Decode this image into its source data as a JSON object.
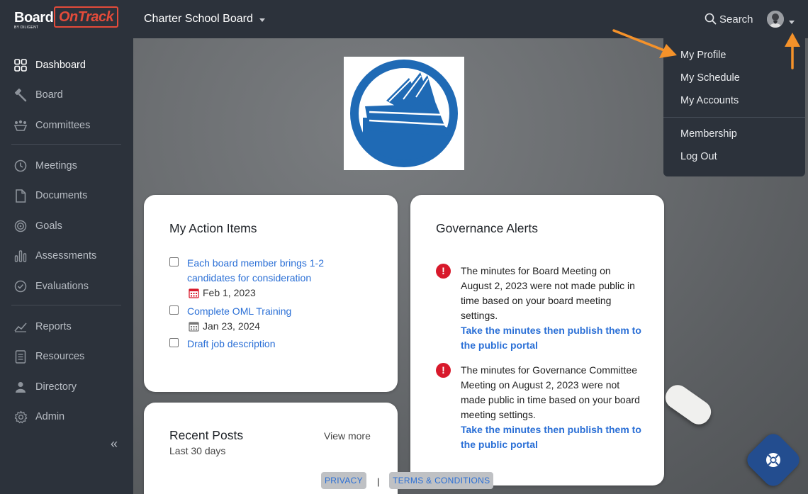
{
  "app": {
    "logo_board": "Board",
    "logo_ontrack": "OnTrack",
    "logo_by": "BY DILIGENT",
    "org_title": "Charter School Board",
    "search_label": "Search"
  },
  "sidebar": {
    "items": [
      {
        "label": "Dashboard",
        "icon": "dashboard-icon"
      },
      {
        "label": "Board",
        "icon": "gavel-icon"
      },
      {
        "label": "Committees",
        "icon": "committees-icon"
      },
      {
        "label": "Meetings",
        "icon": "clock-icon"
      },
      {
        "label": "Documents",
        "icon": "document-icon"
      },
      {
        "label": "Goals",
        "icon": "target-icon"
      },
      {
        "label": "Assessments",
        "icon": "bar-chart-icon"
      },
      {
        "label": "Evaluations",
        "icon": "check-circle-icon"
      },
      {
        "label": "Reports",
        "icon": "line-chart-icon"
      },
      {
        "label": "Resources",
        "icon": "list-doc-icon"
      },
      {
        "label": "Directory",
        "icon": "person-icon"
      },
      {
        "label": "Admin",
        "icon": "gear-icon"
      }
    ],
    "collapse_glyph": "«"
  },
  "user_menu": {
    "items": [
      "My Profile",
      "My Schedule",
      "My Accounts",
      "Membership",
      "Log Out"
    ]
  },
  "action_items": {
    "title": "My Action Items",
    "items": [
      {
        "text": "Each board member brings 1-2 candidates for consideration",
        "date": "Feb 1, 2023",
        "overdue": true
      },
      {
        "text": "Complete OML Training",
        "date": "Jan 23, 2024",
        "overdue": false
      },
      {
        "text": "Draft job description",
        "date": ""
      }
    ]
  },
  "governance_alerts": {
    "title": "Governance Alerts",
    "alerts": [
      {
        "text": "The minutes for Board Meeting on August 2, 2023 were not made public in time based on your board meeting settings.",
        "link": "Take the minutes then publish them to the public portal"
      },
      {
        "text": "The minutes for Governance Committee Meeting on August 2, 2023 were not made public in time based on your board meeting settings.",
        "link": "Take the minutes then publish them to the public portal"
      }
    ]
  },
  "recent_posts": {
    "title": "Recent Posts",
    "subtitle": "Last 30 days",
    "view_more": "View more"
  },
  "footer": {
    "privacy": "PRIVACY",
    "separator": "|",
    "terms": "TERMS & CONDITIONS"
  },
  "colors": {
    "chrome": "#2c323b",
    "link": "#2a6fd6",
    "alert": "#d8192b",
    "brand_red": "#e44b3a",
    "annotation_arrow": "#f5922a",
    "school_logo_blue": "#1f6ab5"
  }
}
